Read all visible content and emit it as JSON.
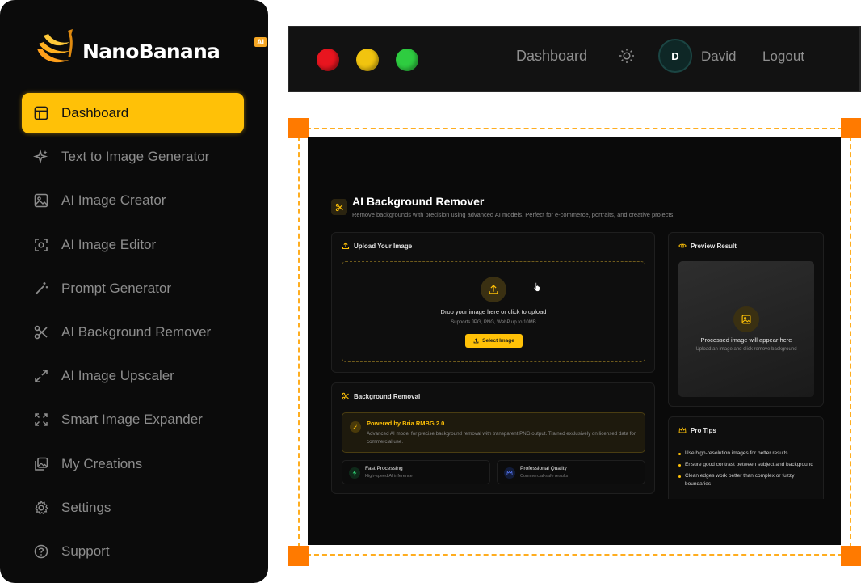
{
  "brand": {
    "name": "NanoBanana",
    "badge": "AI",
    "accent": "#ffc107",
    "logo_icon": "banana-bunch-icon"
  },
  "sidebar": {
    "items": [
      {
        "label": "Dashboard",
        "icon": "layout-icon",
        "active": true
      },
      {
        "label": "Text to Image Generator",
        "icon": "sparkles-icon",
        "active": false
      },
      {
        "label": "AI Image Creator",
        "icon": "image-icon",
        "active": false
      },
      {
        "label": "AI Image Editor",
        "icon": "scan-icon",
        "active": false
      },
      {
        "label": "Prompt Generator",
        "icon": "magic-wand-icon",
        "active": false
      },
      {
        "label": "AI Background Remover",
        "icon": "scissors-icon",
        "active": false
      },
      {
        "label": "AI Image Upscaler",
        "icon": "expand-arrows-icon",
        "active": false
      },
      {
        "label": "Smart Image Expander",
        "icon": "fullscreen-icon",
        "active": false
      },
      {
        "label": "My Creations",
        "icon": "images-icon",
        "active": false
      },
      {
        "label": "Settings",
        "icon": "gear-icon",
        "active": false
      },
      {
        "label": "Support",
        "icon": "help-circle-icon",
        "active": false
      }
    ]
  },
  "topbar": {
    "window_controls": [
      "close",
      "minimize",
      "maximize"
    ],
    "dashboard_label": "Dashboard",
    "theme_icon": "sun-icon",
    "avatar_initial": "D",
    "user_name": "David",
    "logout_label": "Logout"
  },
  "app": {
    "title": "AI Background Remover",
    "subtitle": "Remove backgrounds with precision using advanced AI models. Perfect for e-commerce, portraits, and creative projects.",
    "upload": {
      "heading": "Upload Your Image",
      "drop_text": "Drop your image here or click to upload",
      "supports_text": "Supports JPG, PNG, WebP up to 10MB",
      "button_label": "Select Image"
    },
    "background_removal": {
      "heading": "Background Removal",
      "model_title": "Powered by Bria RMBG 2.0",
      "model_desc": "Advanced AI model for precise background removal with transparent PNG output. Trained exclusively on licensed data for commercial use.",
      "features": [
        {
          "title": "Fast Processing",
          "sub": "High-speed AI inference",
          "icon": "lightning-icon",
          "color": "#1f6f3f"
        },
        {
          "title": "Professional Quality",
          "sub": "Commercial-safe results",
          "icon": "crown-icon",
          "color": "#2a3f8a"
        }
      ]
    },
    "preview": {
      "heading": "Preview Result",
      "placeholder_title": "Processed image will appear here",
      "placeholder_sub": "Upload an image and click remove background"
    },
    "tips": {
      "heading": "Pro Tips",
      "items": [
        "Use high-resolution images for better results",
        "Ensure good contrast between subject and background",
        "Clean edges work better than complex or fuzzy boundaries"
      ]
    }
  }
}
